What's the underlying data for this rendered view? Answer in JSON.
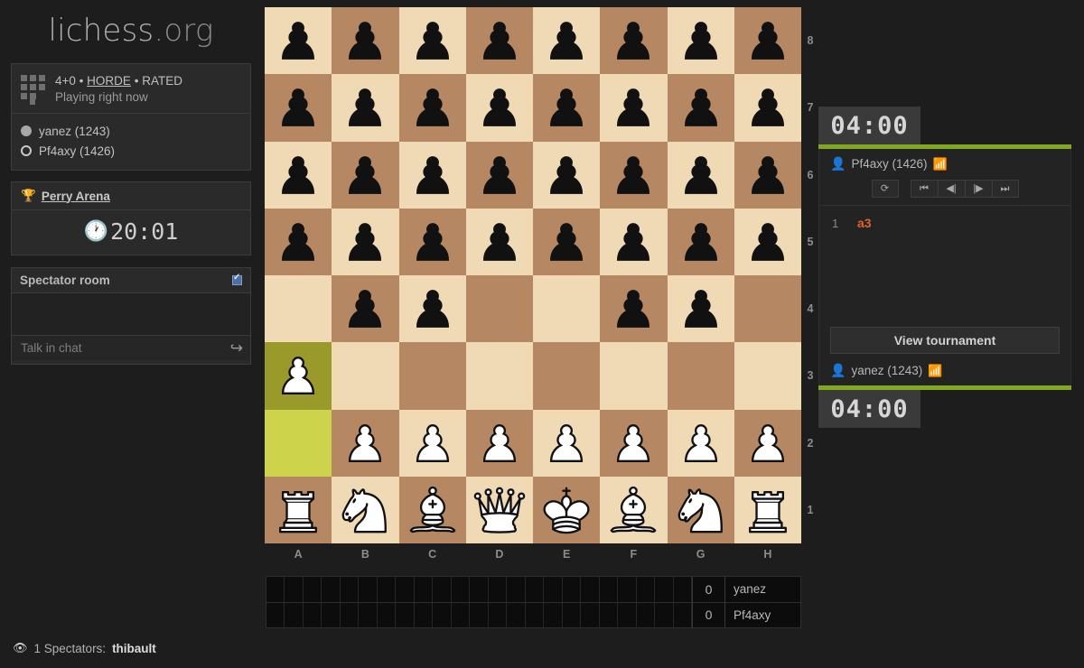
{
  "brand": {
    "name": "lichess",
    "tld": ".org"
  },
  "game_info": {
    "icon": "variant-grid-icon",
    "clock_setting": "4+0",
    "sep1": "•",
    "variant": "HORDE",
    "sep2": "•",
    "rated": "RATED",
    "status": "Playing right now",
    "players": [
      {
        "color": "black",
        "name": "yanez (1243)"
      },
      {
        "color": "white",
        "name": "Pf4axy (1426)"
      }
    ]
  },
  "tournament": {
    "icon": "trophy-icon",
    "name": "Perry Arena",
    "clock_icon": "clock-icon",
    "time_left": "20:01"
  },
  "chat": {
    "title": "Spectator room",
    "checkbox_checked": true,
    "input_placeholder": "Talk in chat",
    "send_icon": "send-arrow-icon",
    "messages": []
  },
  "spectators": {
    "icon": "eye-icon",
    "count_label": "1 Spectators:",
    "names": "thibault"
  },
  "board": {
    "files": [
      "A",
      "B",
      "C",
      "D",
      "E",
      "F",
      "G",
      "H"
    ],
    "ranks": [
      "8",
      "7",
      "6",
      "5",
      "4",
      "3",
      "2",
      "1"
    ],
    "light_color": "#f0d9b5",
    "dark_color": "#b58863",
    "highlight_light": "#cdd34a",
    "highlight_dark": "#9a9a2a",
    "highlighted_squares": [
      "a3",
      "a2"
    ],
    "pieces": [
      [
        "bp",
        "bp",
        "bp",
        "bp",
        "bp",
        "bp",
        "bp",
        "bp"
      ],
      [
        "bp",
        "bp",
        "bp",
        "bp",
        "bp",
        "bp",
        "bp",
        "bp"
      ],
      [
        "bp",
        "bp",
        "bp",
        "bp",
        "bp",
        "bp",
        "bp",
        "bp"
      ],
      [
        "bp",
        "bp",
        "bp",
        "bp",
        "bp",
        "bp",
        "bp",
        "bp"
      ],
      [
        "",
        "bp",
        "bp",
        "",
        "",
        "bp",
        "bp",
        ""
      ],
      [
        "wp",
        "",
        "",
        "",
        "",
        "",
        "",
        ""
      ],
      [
        "",
        "wp",
        "wp",
        "wp",
        "wp",
        "wp",
        "wp",
        "wp"
      ],
      [
        "wr",
        "wn",
        "wb",
        "wq",
        "wk",
        "wb",
        "wn",
        "wr"
      ]
    ]
  },
  "crosstable": {
    "cells_per_row": 23,
    "rows": [
      {
        "score": "0",
        "name": "yanez"
      },
      {
        "score": "0",
        "name": "Pf4axy"
      }
    ]
  },
  "right_panel": {
    "accent_color": "#7fa81e",
    "top_clock": "04:00",
    "bottom_clock": "04:00",
    "top_player": {
      "icon": "user-icon",
      "name": "Pf4axy (1426)",
      "rss_icon": "rss-icon"
    },
    "bottom_player": {
      "icon": "user-icon",
      "name": "yanez (1243)",
      "rss_icon": "rss-icon"
    },
    "controls": [
      {
        "name": "flip-board-button",
        "glyph": "⟳"
      },
      {
        "name": "first-move-button",
        "glyph": "⏮"
      },
      {
        "name": "previous-move-button",
        "glyph": "◀|"
      },
      {
        "name": "next-move-button",
        "glyph": "|▶"
      },
      {
        "name": "last-move-button",
        "glyph": "⏭"
      }
    ],
    "moves": [
      {
        "number": "1",
        "san": "a3"
      }
    ],
    "view_tournament_label": "View tournament"
  }
}
